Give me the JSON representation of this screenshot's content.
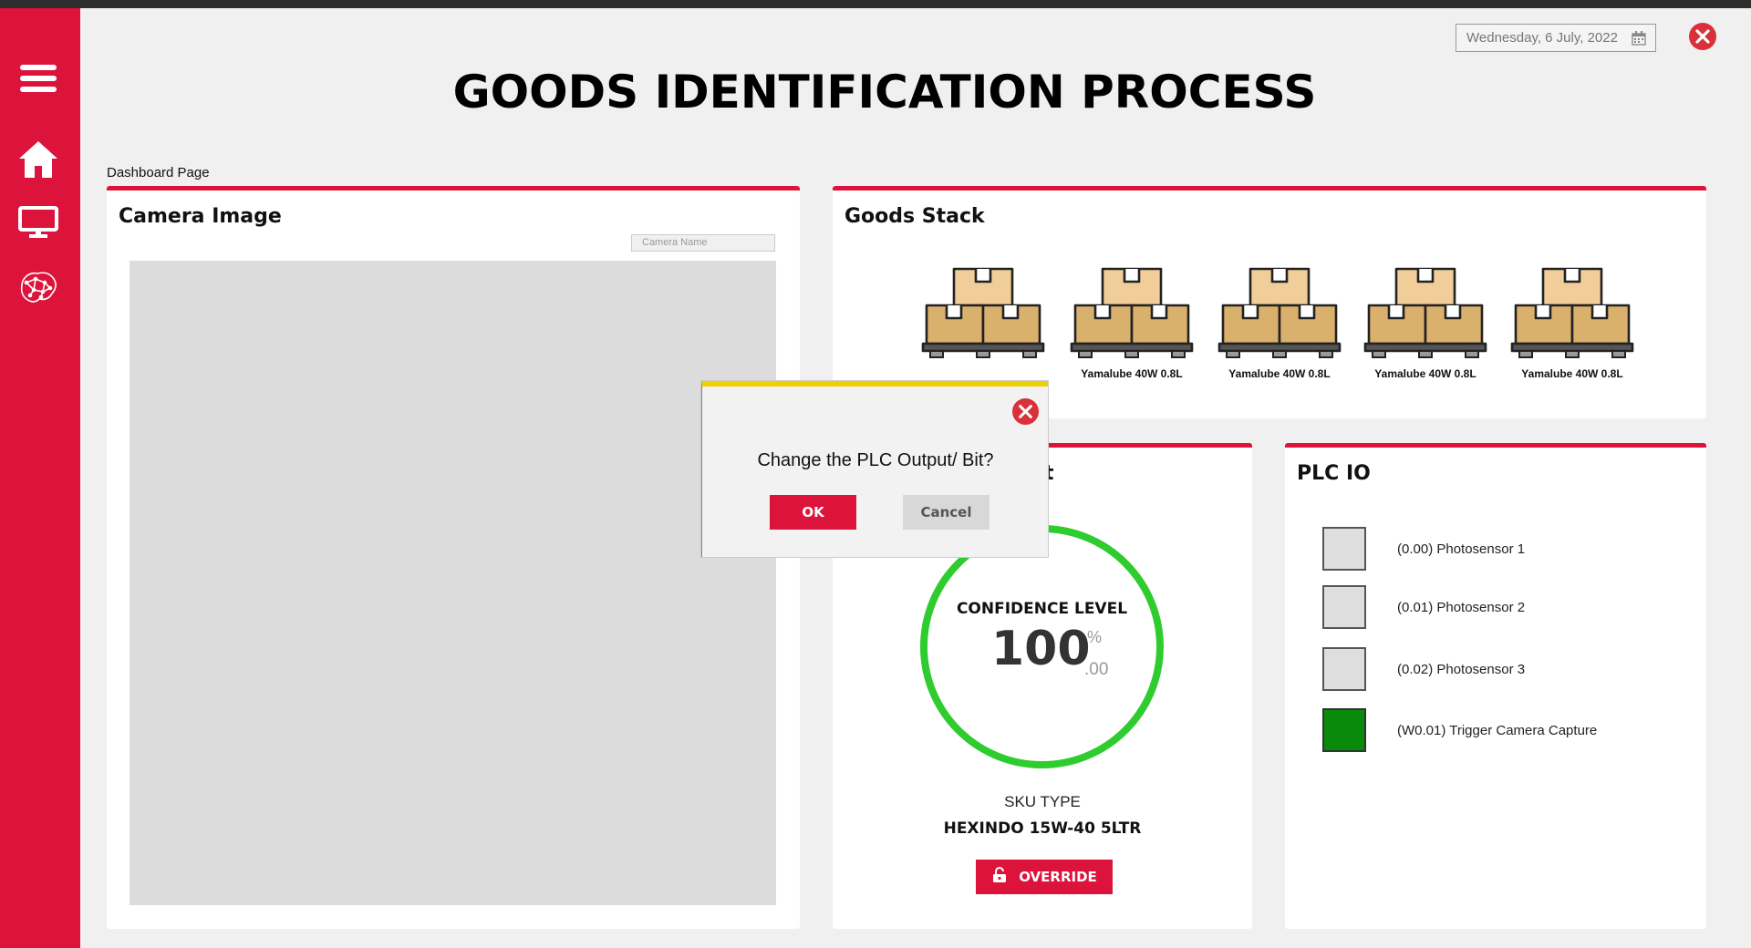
{
  "header": {
    "title": "GOODS IDENTIFICATION PROCESS",
    "date": "Wednesday, 6 July, 2022",
    "breadcrumb": "Dashboard Page"
  },
  "sidebar": {
    "items": [
      {
        "icon": "hamburger-menu-icon"
      },
      {
        "icon": "home-icon"
      },
      {
        "icon": "monitor-icon"
      },
      {
        "icon": "neural-network-icon"
      }
    ]
  },
  "camera_card": {
    "title": "Camera Image",
    "camera_name_placeholder": "Camera Name"
  },
  "goods_card": {
    "title": "Goods Stack",
    "pallets": [
      {
        "label": ""
      },
      {
        "label": "Yamalube 40W 0.8L"
      },
      {
        "label": "Yamalube 40W 0.8L"
      },
      {
        "label": "Yamalube 40W 0.8L"
      },
      {
        "label": "Yamalube 40W 0.8L"
      }
    ]
  },
  "result_card": {
    "title_visible": "t",
    "confidence_label": "CONFIDENCE LEVEL",
    "confidence_value": "100",
    "confidence_unit": "%",
    "confidence_decimal": ".00",
    "sku_label": "SKU TYPE",
    "sku_value": "HEXINDO 15W-40 5LTR",
    "override_label": "OVERRIDE"
  },
  "plc_card": {
    "title": "PLC IO",
    "io": [
      {
        "label": "(0.00) Photosensor 1",
        "active": false
      },
      {
        "label": "(0.01) Photosensor 2",
        "active": false
      },
      {
        "label": "(0.02) Photosensor 3",
        "active": false
      },
      {
        "label": "(W0.01) Trigger Camera Capture",
        "active": true
      }
    ]
  },
  "dialog": {
    "message": "Change the PLC Output/ Bit?",
    "ok_label": "OK",
    "cancel_label": "Cancel"
  },
  "colors": {
    "accent": "#dc143c",
    "ring": "#2ecc2e",
    "io_active": "#0a8a0a",
    "dialog_top": "#f0d000"
  }
}
